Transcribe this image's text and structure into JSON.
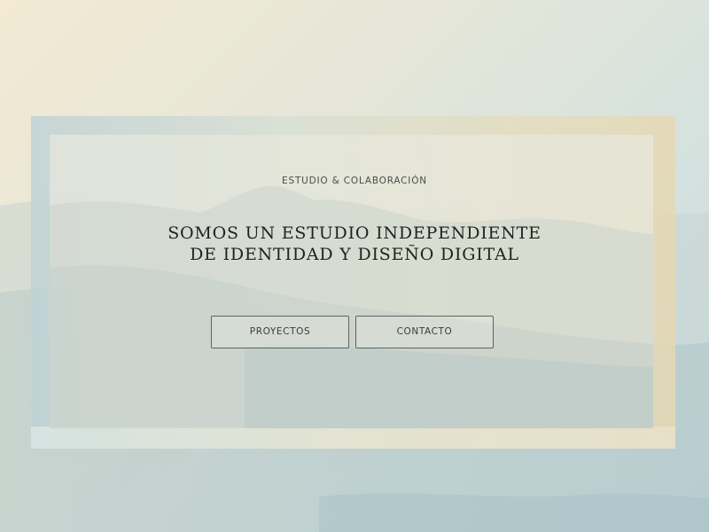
{
  "hero": {
    "eyebrow": "ESTUDIO & COLABORACIÓN",
    "headline_line1": "SOMOS UN ESTUDIO INDEPENDIENTE",
    "headline_line2": "DE IDENTIDAD Y DISEÑO DIGITAL"
  },
  "buttons": {
    "projects_label": "PROYECTOS",
    "contact_label": "CONTACTO"
  },
  "colors": {
    "text_dark": "#1f2221",
    "text_muted": "#4a4d4c",
    "button_border": "#5d6360",
    "frame_blue": "#bfd2d6",
    "frame_sand": "#e6d8b3"
  }
}
